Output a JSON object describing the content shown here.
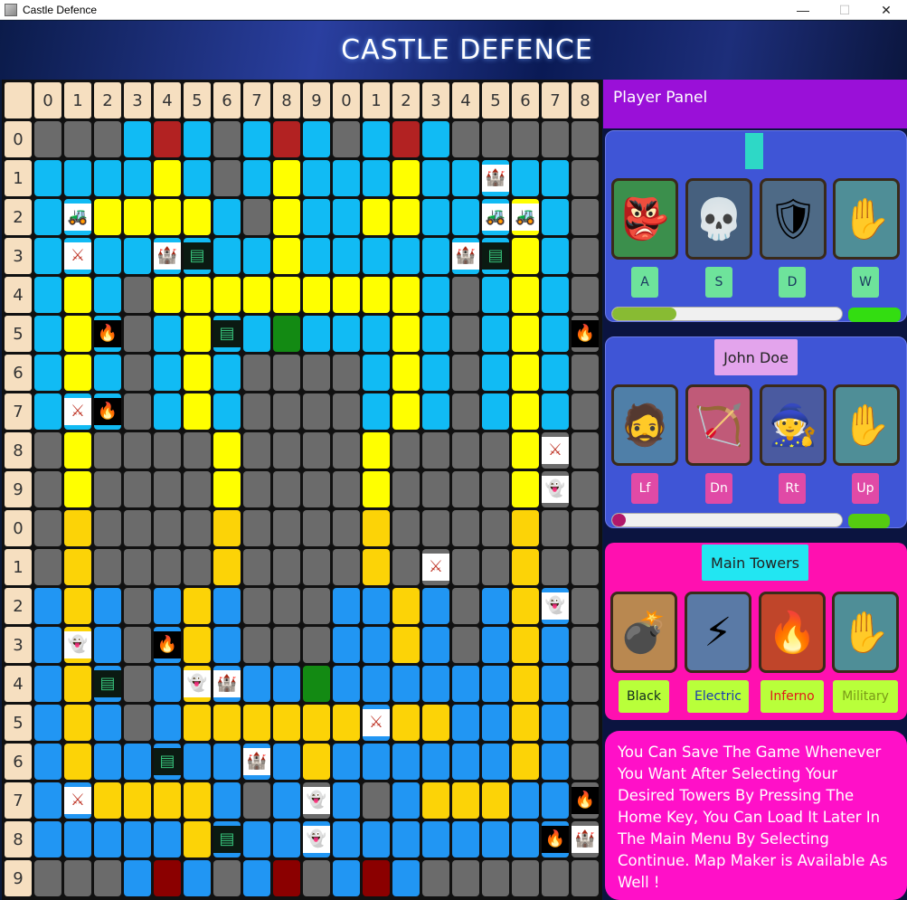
{
  "window": {
    "title": "Castle Defence",
    "controls": [
      "—",
      "☐",
      "✕"
    ]
  },
  "header": {
    "title": "CASTLE DEFENCE"
  },
  "board": {
    "col_headers": [
      "0",
      "1",
      "2",
      "3",
      "4",
      "5",
      "6",
      "7",
      "8",
      "9",
      "0",
      "1",
      "2",
      "3",
      "4",
      "5",
      "6",
      "7",
      "8"
    ],
    "row_headers": [
      "0",
      "1",
      "2",
      "3",
      "4",
      "5",
      "6",
      "7",
      "8",
      "9",
      "0",
      "1",
      "2",
      "3",
      "4",
      "5",
      "6",
      "7",
      "8",
      "9"
    ],
    "rows": [
      "gggbrbgbrbgbrbgggg",
      "bbbbybgbybbbybbbbb",
      "bbyyyybgybbyybbbyb",
      "bbbbbbbbybbbbbbbyb",
      "bybgyyyyyyyyybgbyb",
      "bybgbybbGbbbybgbyb",
      "bybgbybggggbybgbyb",
      "bbbgbybggggbybgbyb",
      "gyggggyggggyggggyg",
      "gyggggyggggyggggyg",
      "goggggoggggoggggog",
      "goggggoggggoggggog",
      "BoBgBoBgggBBoBgBoB",
      "BoBgBoBgggBBoBgBoB",
      "BoBgBoBBBGBBBBBBoB",
      "BoBgBooooooBooBBoB",
      "BoBBBBBBBoBBBBBBoB",
      "BBooooBgBgBgBoooBB",
      "BBBBBoBBBBBBBBBBBB",
      "gggBRBgBRgBRBggggg"
    ],
    "tokens": [
      {
        "r": 1,
        "c": 15,
        "kind": "castle",
        "glyph": "🏰"
      },
      {
        "r": 2,
        "c": 1,
        "kind": "tank",
        "glyph": "🚜"
      },
      {
        "r": 2,
        "c": 15,
        "kind": "tank",
        "glyph": "🚜"
      },
      {
        "r": 2,
        "c": 16,
        "kind": "tank",
        "glyph": "🚜"
      },
      {
        "r": 3,
        "c": 1,
        "kind": "soldier",
        "glyph": "⚔"
      },
      {
        "r": 3,
        "c": 4,
        "kind": "castle",
        "glyph": "🏰"
      },
      {
        "r": 3,
        "c": 5,
        "kind": "wall",
        "glyph": "▤"
      },
      {
        "r": 3,
        "c": 14,
        "kind": "castle",
        "glyph": "🏰"
      },
      {
        "r": 3,
        "c": 15,
        "kind": "wall",
        "glyph": "▤"
      },
      {
        "r": 5,
        "c": 2,
        "kind": "fire",
        "glyph": "🔥"
      },
      {
        "r": 5,
        "c": 6,
        "kind": "wall",
        "glyph": "▤"
      },
      {
        "r": 5,
        "c": 18,
        "kind": "fire",
        "glyph": "🔥"
      },
      {
        "r": 7,
        "c": 1,
        "kind": "soldier",
        "glyph": "⚔"
      },
      {
        "r": 7,
        "c": 2,
        "kind": "fire",
        "glyph": "🔥"
      },
      {
        "r": 8,
        "c": 17,
        "kind": "soldier",
        "glyph": "⚔"
      },
      {
        "r": 9,
        "c": 17,
        "kind": "ghost",
        "glyph": "👻"
      },
      {
        "r": 11,
        "c": 13,
        "kind": "soldier",
        "glyph": "⚔"
      },
      {
        "r": 12,
        "c": 17,
        "kind": "ghost",
        "glyph": "👻"
      },
      {
        "r": 13,
        "c": 1,
        "kind": "ghost",
        "glyph": "👻"
      },
      {
        "r": 13,
        "c": 4,
        "kind": "fire",
        "glyph": "🔥"
      },
      {
        "r": 14,
        "c": 2,
        "kind": "wall",
        "glyph": "▤"
      },
      {
        "r": 14,
        "c": 5,
        "kind": "ghost",
        "glyph": "👻"
      },
      {
        "r": 14,
        "c": 6,
        "kind": "castle",
        "glyph": "🏰"
      },
      {
        "r": 15,
        "c": 11,
        "kind": "soldier",
        "glyph": "⚔"
      },
      {
        "r": 16,
        "c": 4,
        "kind": "wall",
        "glyph": "▤"
      },
      {
        "r": 16,
        "c": 7,
        "kind": "castle",
        "glyph": "🏰"
      },
      {
        "r": 17,
        "c": 1,
        "kind": "soldier",
        "glyph": "⚔"
      },
      {
        "r": 17,
        "c": 9,
        "kind": "ghost",
        "glyph": "👻"
      },
      {
        "r": 17,
        "c": 18,
        "kind": "fire",
        "glyph": "🔥"
      },
      {
        "r": 18,
        "c": 6,
        "kind": "wall",
        "glyph": "▤"
      },
      {
        "r": 18,
        "c": 9,
        "kind": "ghost",
        "glyph": "👻"
      },
      {
        "r": 18,
        "c": 17,
        "kind": "fire",
        "glyph": "🔥"
      },
      {
        "r": 18,
        "c": 18,
        "kind": "castle",
        "glyph": "🏰"
      }
    ]
  },
  "panel": {
    "title": "Player Panel",
    "player1": {
      "cards": [
        {
          "name": "goblin",
          "glyph": "👺",
          "bg": "#3b8f4c"
        },
        {
          "name": "skeleton-knight",
          "glyph": "💀",
          "bg": "#46607e"
        },
        {
          "name": "knight",
          "glyph": "🛡",
          "bg": "#4e6a86"
        },
        {
          "name": "zombie-hand",
          "glyph": "✋",
          "bg": "#4f8e97"
        }
      ],
      "keys": [
        "A",
        "S",
        "D",
        "W"
      ],
      "progress": 0.28
    },
    "player2": {
      "name": "John Doe",
      "cards": [
        {
          "name": "giant",
          "glyph": "🧔",
          "bg": "#4f7fa8"
        },
        {
          "name": "archer",
          "glyph": "🏹",
          "bg": "#c05a78"
        },
        {
          "name": "wizard",
          "glyph": "🧙",
          "bg": "#4a5aa0"
        },
        {
          "name": "zombie-hand",
          "glyph": "✋",
          "bg": "#4f8e97"
        }
      ],
      "keys": [
        "Lf",
        "Dn",
        "Rt",
        "Up"
      ],
      "progress": 0.06
    },
    "towers": {
      "title": "Main Towers",
      "cards": [
        {
          "name": "bomb-tower",
          "glyph": "💣",
          "bg": "#b98850"
        },
        {
          "name": "electric-tower",
          "glyph": "⚡",
          "bg": "#5a7aa6"
        },
        {
          "name": "inferno-tower",
          "glyph": "🔥",
          "bg": "#c0452a"
        },
        {
          "name": "zombie-hand",
          "glyph": "✋",
          "bg": "#4f8e97"
        }
      ],
      "labels": [
        "Black",
        "Electric",
        "Inferno",
        "Military"
      ],
      "label_colors": [
        "#102a20",
        "#1a3ab0",
        "#e01a1a",
        "#7a9a18"
      ]
    },
    "info": "You Can Save The Game Whenever You Want After Selecting Your Desired Towers By Pressing The Home Key, You Can Load It Later In The Main Menu By Selecting Continue. Map Maker is Available As Well !"
  }
}
